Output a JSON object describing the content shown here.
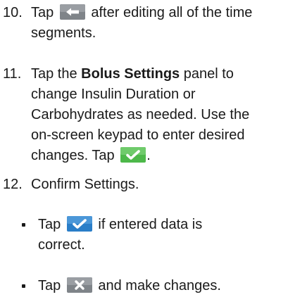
{
  "step10": {
    "number": "10.",
    "before_icon": "Tap",
    "icon": "back-arrow-icon",
    "after_icon": "after editing all of the time",
    "line2": "segments."
  },
  "step11": {
    "number": "11.",
    "text_a": "Tap the",
    "bold": "Bolus Settings",
    "text_b": "panel to",
    "line2": "change Insulin Duration or",
    "line3": "Carbohydrates as needed. Use the",
    "line4": "on-screen keypad to enter desired",
    "line5_a": "changes. Tap",
    "icon": "green-check-icon",
    "line5_b": "."
  },
  "step12": {
    "number": "12.",
    "text": "Confirm Settings.",
    "bullets": [
      {
        "before_icon": "Tap",
        "icon": "blue-check-icon",
        "after_icon": "if entered data is",
        "line2": "correct."
      },
      {
        "before_icon": "Tap",
        "icon": "x-icon",
        "after_icon": "and make changes."
      }
    ]
  },
  "colors": {
    "text": "#1a1a1a",
    "button_gray": "#7f8489",
    "button_green": "#4db84a",
    "button_blue": "#2a7ec8"
  }
}
